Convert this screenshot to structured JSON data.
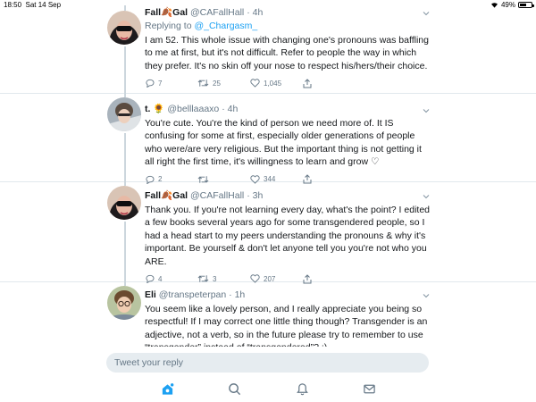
{
  "status_bar": {
    "time": "18:50",
    "date": "Sat 14 Sep",
    "battery_percent": "49%",
    "battery_level": 0.49
  },
  "tweets": [
    {
      "name": "Fall🍂Gal",
      "handle": "@CAFallHall",
      "time": "4h",
      "replying_prefix": "Replying to ",
      "replying_to": "@_Chargasm_",
      "text": "I am 52. This whole issue with changing one's pronouns was baffling to me at first, but it's not difficult. Refer to people the way in which they prefer. It's no skin off your nose to respect his/hers/their choice.",
      "replies": "7",
      "retweets": "25",
      "likes": "1,045"
    },
    {
      "name": "t. 🌻",
      "handle": "@belllaaaxo",
      "time": "4h",
      "text": "You're cute. You're the kind of person we need more of. It IS confusing for some at first, especially older generations of people who were/are very religious. But the important thing is not getting it all right the first time, it's willingness to learn and grow ♡",
      "replies": "2",
      "retweets": "",
      "likes": "344"
    },
    {
      "name": "Fall🍂Gal",
      "handle": "@CAFallHall",
      "time": "3h",
      "text": "Thank you. If you're not learning every day, what's the point? I edited a few books several years ago for some transgendered people, so I had a head start to my peers understanding the pronouns & why it's important. Be yourself & don't let anyone tell you you're not who you ARE.",
      "replies": "4",
      "retweets": "3",
      "likes": "207"
    },
    {
      "name": "Eli",
      "handle": "@transpeterpan",
      "time": "1h",
      "text": "You seem like a lovely person, and I really appreciate you being so respectful! If I may correct one little thing though? Transgender is an adjective, not a verb, so in the future please try to remember to use “transgender” instead of “transgendered”? :)",
      "replies": "",
      "retweets": "",
      "likes": ""
    }
  ],
  "reply_box": {
    "placeholder": "Tweet your reply"
  },
  "tabs": [
    "home-icon",
    "search-icon",
    "notifications-icon",
    "messages-icon"
  ],
  "colors": {
    "accent": "#1da1f2",
    "secondary_text": "#657786",
    "divider": "#e1e8ed"
  }
}
